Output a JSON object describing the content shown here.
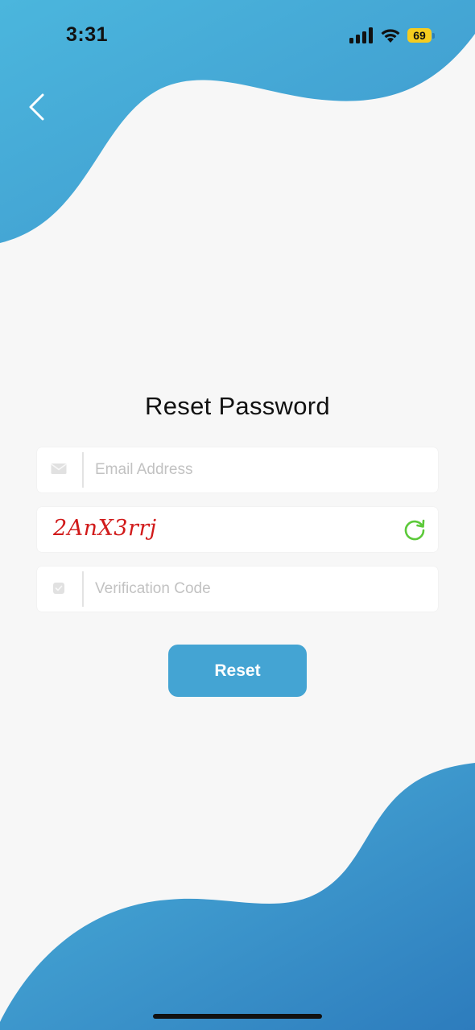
{
  "status_bar": {
    "time": "3:31",
    "battery_level": "69",
    "icons": [
      "signal-icon",
      "wifi-icon",
      "battery-icon"
    ]
  },
  "header": {
    "back_icon": "chevron-left-icon"
  },
  "form": {
    "title": "Reset Password",
    "email": {
      "placeholder": "Email Address",
      "value": "",
      "icon": "envelope-icon"
    },
    "captcha": {
      "text": "2AnX3rrj",
      "refresh_icon": "refresh-icon"
    },
    "verification_code": {
      "placeholder": "Verification Code",
      "value": "",
      "icon": "shield-check-icon"
    },
    "reset_label": "Reset"
  },
  "colors": {
    "accent": "#44a4d3",
    "wave_light": "#4bb4db",
    "wave_dark": "#2f80bf",
    "captcha_text": "#d11a1a",
    "refresh": "#5cc93a",
    "background": "#f7f7f7"
  }
}
